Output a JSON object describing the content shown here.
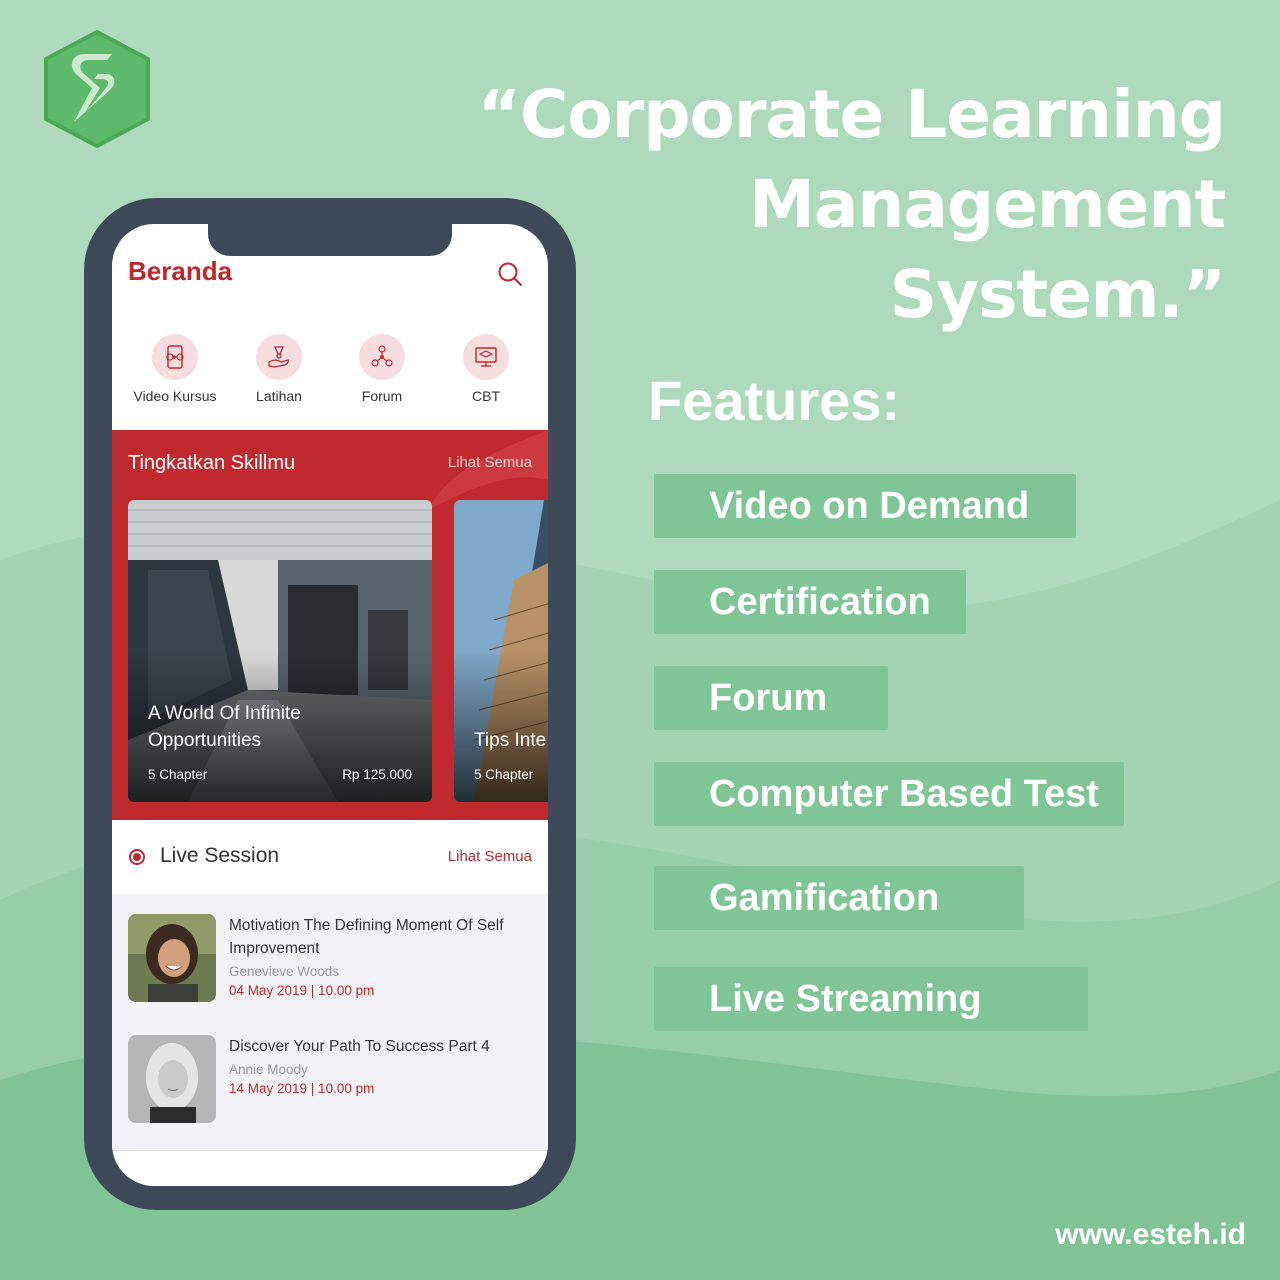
{
  "colors": {
    "background": "#aed9bc",
    "accent_green": "#7fc597",
    "brand_red": "#c0272d",
    "phone_frame": "#3e4a58"
  },
  "headline": {
    "line1": "“Corporate Learning",
    "line2": "Management",
    "line3": "System.”"
  },
  "features": {
    "title": "Features:",
    "items": [
      "Video on Demand",
      "Certification",
      "Forum",
      "Computer Based Test",
      "Gamification",
      "Live Streaming"
    ]
  },
  "website": "www.esteh.id",
  "app": {
    "title": "Beranda",
    "search_icon": "search-icon",
    "menu": [
      {
        "label": "Video Kursus",
        "icon": "video-course-icon"
      },
      {
        "label": "Latihan",
        "icon": "exercise-icon"
      },
      {
        "label": "Forum",
        "icon": "forum-icon"
      },
      {
        "label": "CBT",
        "icon": "computer-test-icon"
      }
    ],
    "skill_section": {
      "title": "Tingkatkan Skillmu",
      "see_all": "Lihat Semua",
      "courses": [
        {
          "title": "A World Of Infinite Opportunities",
          "chapters": "5 Chapter",
          "price": "Rp 125.000"
        },
        {
          "title": "Tips Inte",
          "chapters": "5 Chapter",
          "price": ""
        }
      ]
    },
    "live_session": {
      "title": "Live Session",
      "see_all": "Lihat Semua",
      "sessions": [
        {
          "title": "Motivation The Defining Moment Of Self Improvement",
          "author": "Genevieve Woods",
          "date": "04 May 2019 | 10.00 pm"
        },
        {
          "title": "Discover Your Path To Success Part 4",
          "author": "Annie Moody",
          "date": "14 May 2019 | 10.00 pm"
        }
      ]
    }
  }
}
